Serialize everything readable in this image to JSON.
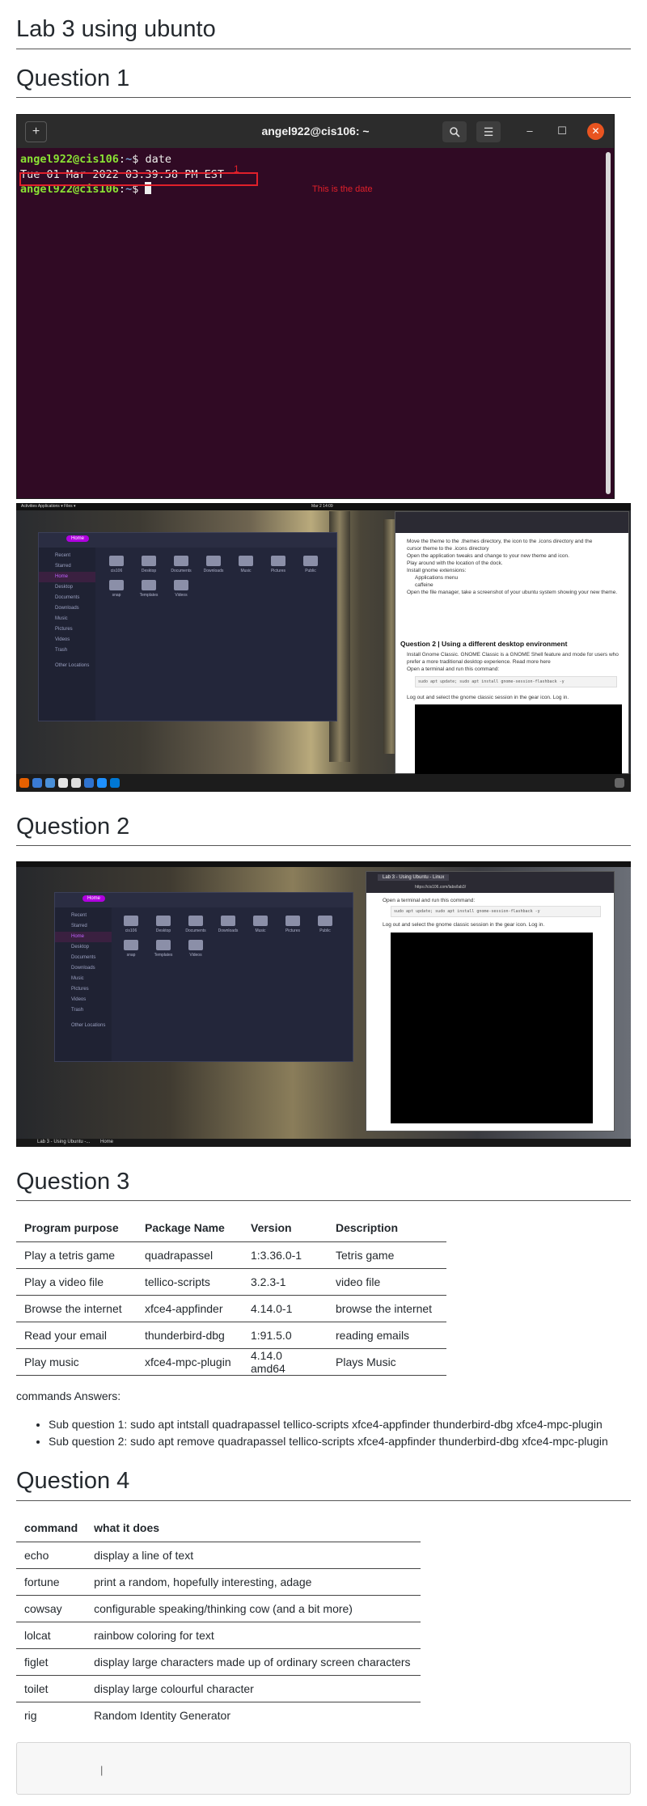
{
  "page_title": "Lab 3 using ubunto",
  "q1": {
    "heading": "Question 1",
    "terminal": {
      "window_title": "angel922@cis106: ~",
      "prompt_user": "angel922@cis106",
      "prompt_sep": ":",
      "prompt_path": "~",
      "prompt_end": "$ ",
      "command": "date",
      "output": "Tue 01 Mar 2022 03:39:58 PM EST",
      "annotation": "This is the date",
      "annotation_number": "1"
    },
    "desktop": {
      "topbar": "Activities   Applications ▾   Files ▾",
      "clock": "Mar 2  14:09",
      "browser_heading": "Question 2 | Using a different desktop environment",
      "browser_lines": [
        "Move the theme to the .themes directory, the icon to the .icons directory and the",
        "cursor theme to the .icons directory",
        "Open the application tweaks and change to your new theme and icon.",
        "Play around with the location of the dock.",
        "Install gnome extensions:",
        "Applications menu",
        "caffeine",
        "Open the file manager, take a screenshot of your ubuntu system showing your new theme."
      ],
      "browser_lines2": [
        "Install Gnome Classic. GNOME Classic is a GNOME Shell feature and mode for users who",
        "prefer a more traditional desktop experience. Read more here",
        "Open a terminal and run this command:",
        "Log out and select the gnome classic session in the gear icon. Log in."
      ],
      "code": "sudo apt update; sudo apt install gnome-session-flashback -y"
    }
  },
  "file_manager": {
    "location": "Home",
    "sidebar": [
      "Recent",
      "Starred",
      "Home",
      "Desktop",
      "Documents",
      "Downloads",
      "Music",
      "Pictures",
      "Videos",
      "Trash",
      "Other Locations"
    ],
    "folders": [
      "cis106",
      "Desktop",
      "Documents",
      "Downloads",
      "Music",
      "Pictures",
      "Public",
      "snap",
      "Templates",
      "Videos"
    ]
  },
  "q2": {
    "heading": "Question 2",
    "browser_tab": "Lab 3 - Using Ubuntu - Linux",
    "url": "https://cis106.com/labs/lab3/",
    "line1": "Open a terminal and run this command:",
    "code": "sudo apt update; sudo apt install gnome-session-flashback -y",
    "line2": "Log out and select the gnome classic session in the gear icon. Log in.",
    "taskbar": [
      "Lab 3 - Using Ubuntu -...",
      "Home"
    ]
  },
  "q3": {
    "heading": "Question 3",
    "table": {
      "headers": [
        "Program purpose",
        "Package Name",
        "Version",
        "Description"
      ],
      "rows": [
        [
          "Play a tetris game",
          "quadrapassel",
          "1:3.36.0-1",
          "Tetris game"
        ],
        [
          "Play a video file",
          "tellico-scripts",
          "3.2.3-1",
          "video file"
        ],
        [
          "Browse the internet",
          "xfce4-appfinder",
          "4.14.0-1",
          "browse the internet"
        ],
        [
          "Read your email",
          "thunderbird-dbg",
          "1:91.5.0",
          "reading emails"
        ],
        [
          "Play music",
          "xfce4-mpc-plugin",
          "4.14.0 amd64",
          "Plays Music"
        ]
      ]
    },
    "answers_label": "commands Answers:",
    "answers": [
      "Sub question 1: sudo apt intstall quadrapassel tellico-scripts xfce4-appfinder thunderbird-dbg xfce4-mpc-plugin",
      "Sub question 2: sudo apt remove quadrapassel tellico-scripts xfce4-appfinder thunderbird-dbg xfce4-mpc-plugin"
    ]
  },
  "q4": {
    "heading": "Question 4",
    "table": {
      "headers": [
        "command",
        "what it does"
      ],
      "rows": [
        [
          "echo",
          "display a line of text"
        ],
        [
          "fortune",
          "print a random, hopefully interesting, adage"
        ],
        [
          "cowsay",
          "configurable speaking/thinking cow (and a bit more)"
        ],
        [
          "lolcat",
          "rainbow coloring for text"
        ],
        [
          "figlet",
          "display large characters made up of ordinary screen characters"
        ],
        [
          "toilet",
          "display large colourful character"
        ],
        [
          "rig",
          "Random Identity Generator"
        ]
      ]
    }
  }
}
